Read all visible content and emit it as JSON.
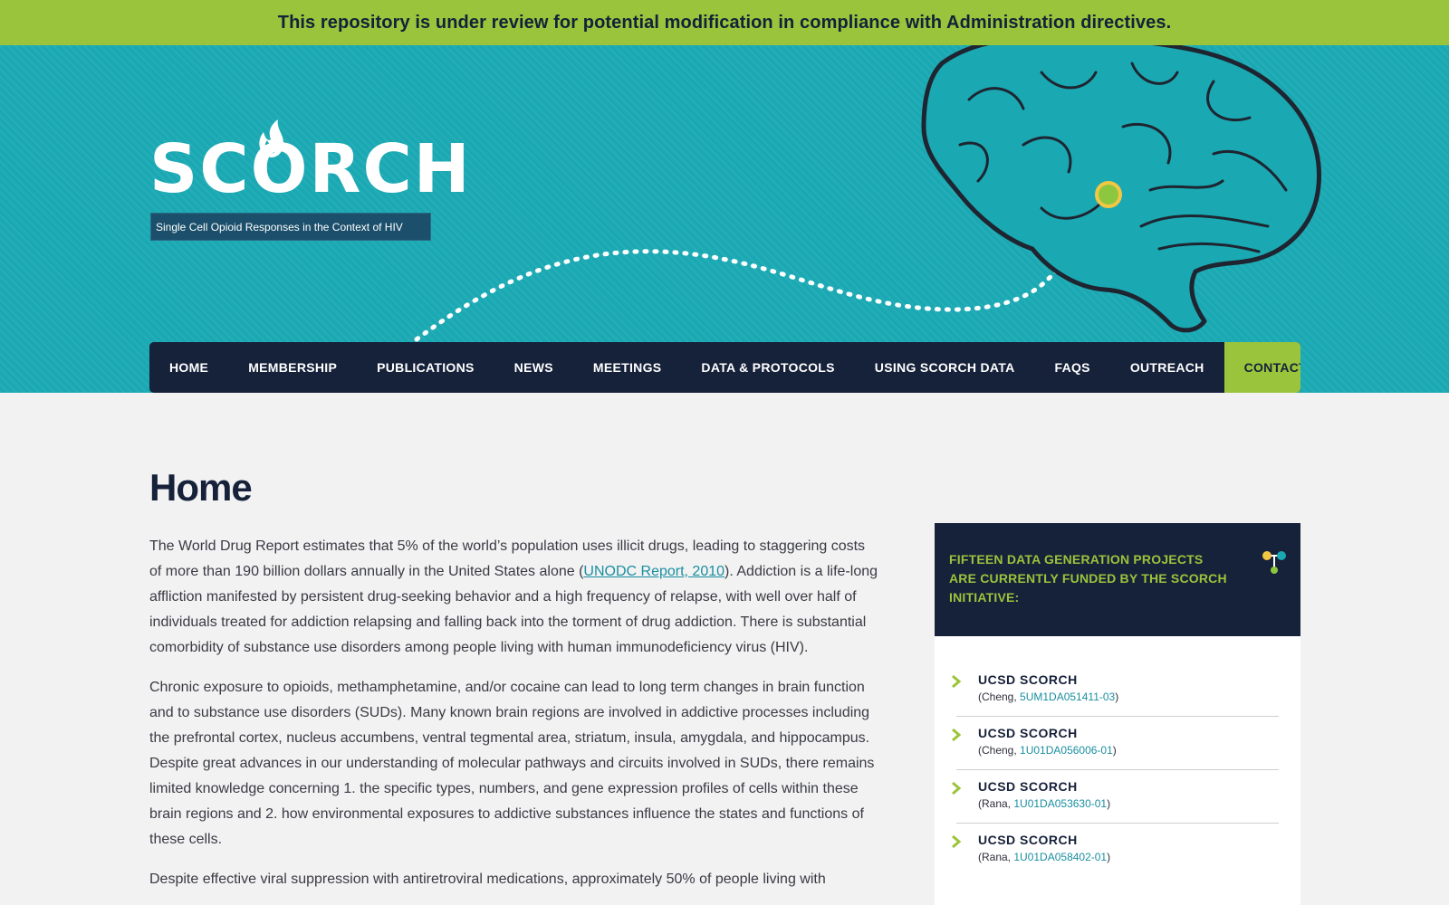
{
  "banner": {
    "text": "This repository is under review for potential modification in compliance with Administration directives."
  },
  "logo": {
    "text": "SCORCH",
    "tagline": "Single Cell Opioid Responses in the Context of HIV"
  },
  "nav": {
    "items": [
      "HOME",
      "MEMBERSHIP",
      "PUBLICATIONS",
      "NEWS",
      "MEETINGS",
      "DATA & PROTOCOLS",
      "USING SCORCH DATA",
      "FAQS",
      "OUTREACH"
    ],
    "contact": "CONTACT"
  },
  "page": {
    "title": "Home"
  },
  "content": {
    "p1_before": "The World Drug Report estimates that 5% of the world’s population uses illicit drugs, leading to staggering costs of more than 190 billion dollars annually in the United States alone (",
    "p1_link": "UNODC Report, 2010",
    "p1_after": "). Addiction is a life-long affliction manifested by persistent drug-seeking behavior and a high frequency of relapse, with well over half of individuals treated for addiction relapsing and falling back into the torment of drug addiction. There is substantial comorbidity of substance use disorders among people living with human immunodeficiency virus (HIV).",
    "p2": "Chronic exposure to opioids, methamphetamine, and/or cocaine can lead to long term changes in brain function and to substance use disorders (SUDs). Many known brain regions are involved in addictive processes including the prefrontal cortex, nucleus accumbens, ventral tegmental area, striatum, insula, amygdala, and hippocampus. Despite great advances in our understanding of molecular pathways and circuits involved in SUDs, there remains limited knowledge concerning 1. the specific types, numbers, and gene expression profiles of cells within these brain regions and 2. how environmental exposures to addictive substances influence the states and functions of these cells.",
    "p3": "Despite effective viral suppression with antiretroviral medications, approximately 50% of people living with"
  },
  "sidebar": {
    "heading": "Fifteen data generation projects are currently funded by the SCORCH initiative:",
    "projects": [
      {
        "name": "UCSD SCORCH",
        "pi": "(Cheng, ",
        "grant": "5UM1DA051411-03",
        "close": ")"
      },
      {
        "name": "UCSD SCORCH",
        "pi": "(Cheng, ",
        "grant": "1U01DA056006-01",
        "close": ")"
      },
      {
        "name": "UCSD SCORCH",
        "pi": "(Rana, ",
        "grant": "1U01DA053630-01",
        "close": ")"
      },
      {
        "name": "UCSD SCORCH",
        "pi": "(Rana, ",
        "grant": "1U01DA058402-01",
        "close": ")"
      }
    ]
  },
  "colors": {
    "teal": "#1aa9b3",
    "navy": "#16213a",
    "green": "#9ac43b",
    "link": "#1a8fa0"
  },
  "icons": [
    "flame-icon",
    "brain-illustration",
    "chevron-right-icon",
    "molecule-icon"
  ]
}
